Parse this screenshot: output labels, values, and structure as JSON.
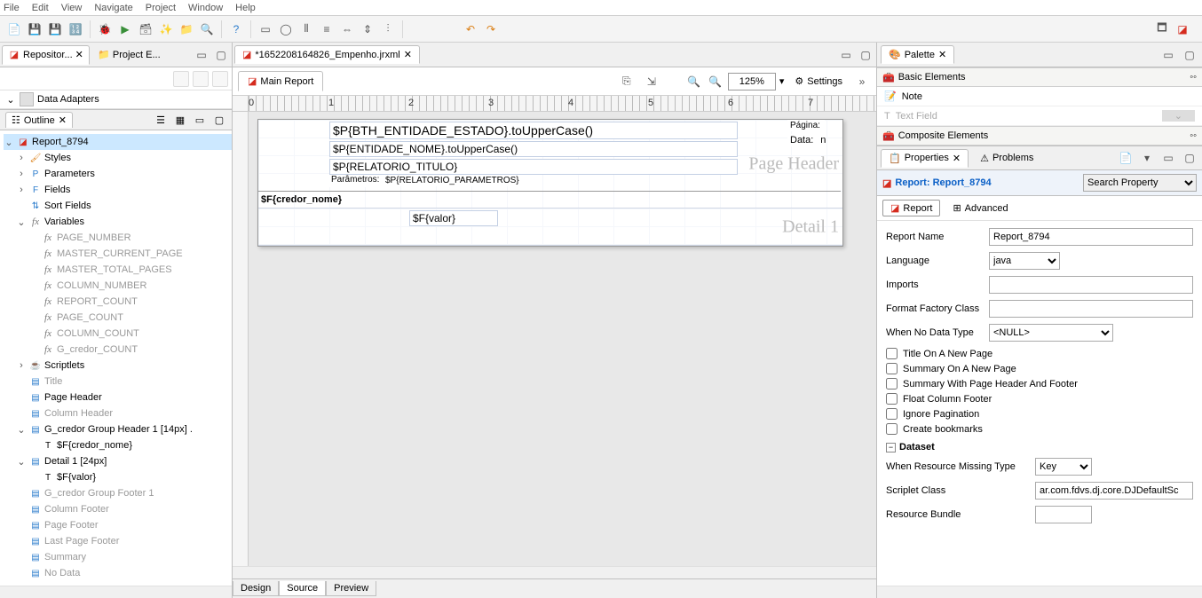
{
  "menu": [
    "File",
    "Edit",
    "View",
    "Navigate",
    "Project",
    "Window",
    "Help"
  ],
  "tabs": {
    "left": [
      {
        "label": "Repositor...",
        "active": true
      },
      {
        "label": "Project E..."
      }
    ],
    "editor": [
      {
        "label": "*1652208164826_Empenho.jrxml",
        "active": true
      }
    ],
    "palette": {
      "label": "Palette"
    }
  },
  "dataAdapters": {
    "label": "Data Adapters"
  },
  "outline": {
    "title": "Outline",
    "root": "Report_8794",
    "nodes": {
      "styles": "Styles",
      "parameters": "Parameters",
      "fields": "Fields",
      "sortFields": "Sort Fields",
      "variables": "Variables",
      "var_list": [
        "PAGE_NUMBER",
        "MASTER_CURRENT_PAGE",
        "MASTER_TOTAL_PAGES",
        "COLUMN_NUMBER",
        "REPORT_COUNT",
        "PAGE_COUNT",
        "COLUMN_COUNT",
        "G_credor_COUNT"
      ],
      "scriptlets": "Scriptlets",
      "title_band": "Title",
      "pageHeader": "Page Header",
      "columnHeader": "Column Header",
      "groupHeader": "G_credor Group Header 1 [14px] .",
      "ghField": "$F{credor_nome}",
      "detail": "Detail 1 [24px]",
      "detField": "$F{valor}",
      "groupFooter": "G_credor Group Footer 1",
      "columnFooter": "Column Footer",
      "pageFooter": "Page Footer",
      "lastPageFooter": "Last Page Footer",
      "summary": "Summary",
      "noData": "No Data"
    }
  },
  "editor": {
    "mainReport": "Main Report",
    "zoom": "125%",
    "settings": "Settings",
    "designTabs": [
      "Design",
      "Source",
      "Preview"
    ],
    "activeTab": "Source"
  },
  "canvas": {
    "ph_expr1": "$P{BTH_ENTIDADE_ESTADO}.toUpperCase()",
    "ph_expr2": "$P{ENTIDADE_NOME}.toUpperCase()",
    "ph_title": "$P{RELATORIO_TITULO}",
    "ph_params_lbl": "Parâmetros:",
    "ph_params": "$P{RELATORIO_PARAMETROS}",
    "ph_pagina": "Página:",
    "ph_data": "Data:",
    "ph_n": "n",
    "gh_field": "$F{credor_nome}",
    "d1_field": "$F{valor}",
    "band_ph": "Page Header",
    "band_d1": "Detail 1"
  },
  "palette": {
    "sections": {
      "basic": "Basic Elements",
      "note": "Note",
      "textField": "Text Field",
      "composite": "Composite Elements"
    }
  },
  "properties": {
    "tabLabel": "Properties",
    "problemsLabel": "Problems",
    "headerTitle": "Report: Report_8794",
    "search": "Search Property",
    "subTabs": [
      "Report",
      "Advanced"
    ],
    "reportName": {
      "label": "Report Name",
      "value": "Report_8794"
    },
    "language": {
      "label": "Language",
      "value": "java"
    },
    "imports": {
      "label": "Imports",
      "value": ""
    },
    "formatFactory": {
      "label": "Format Factory Class",
      "value": ""
    },
    "whenNoData": {
      "label": "When No Data Type",
      "value": "<NULL>"
    },
    "checks": [
      "Title On A New Page",
      "Summary On A New Page",
      "Summary With Page Header And Footer",
      "Float Column Footer",
      "Ignore Pagination",
      "Create bookmarks"
    ],
    "dataset": "Dataset",
    "whenResMissing": {
      "label": "When Resource Missing Type",
      "value": "Key"
    },
    "scriptlet": {
      "label": "Scriplet Class",
      "value": "ar.com.fdvs.dj.core.DJDefaultSc"
    },
    "resourceBundle": {
      "label": "Resource Bundle",
      "value": ""
    }
  }
}
